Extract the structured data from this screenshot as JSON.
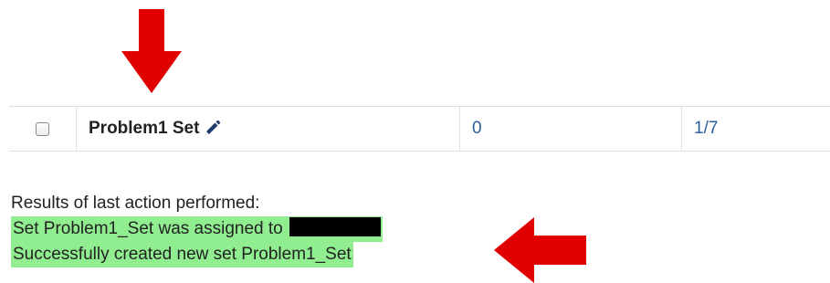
{
  "table_row": {
    "name": "Problem1 Set",
    "count": "0",
    "ratio": "1/7",
    "checked": false
  },
  "results": {
    "heading": "Results of last action performed:",
    "messages": [
      {
        "text": "Set Problem1_Set was assigned to",
        "redacted_suffix": true
      },
      {
        "text": "Successfully created new set Problem1_Set",
        "redacted_suffix": false
      }
    ]
  },
  "colors": {
    "arrow": "#e00000",
    "success_bg": "#90ee90",
    "link": "#2a5d9a"
  },
  "icons": {
    "edit": "pencil-icon",
    "arrow_down": "red-arrow-down-icon",
    "arrow_left": "red-arrow-left-icon"
  }
}
